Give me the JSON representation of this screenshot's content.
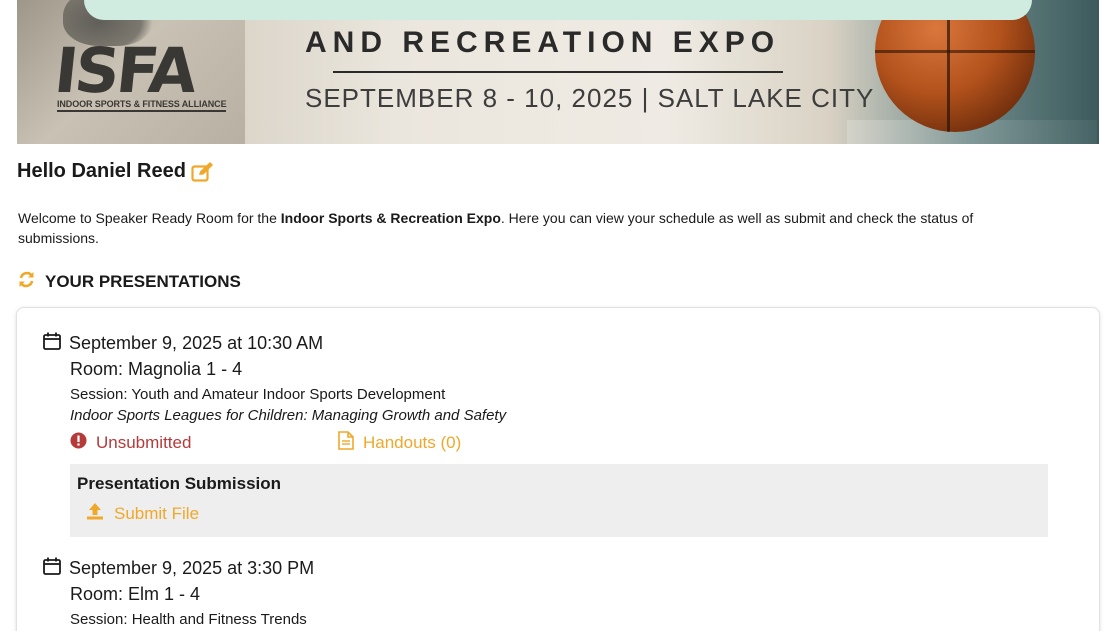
{
  "banner": {
    "logo_text": "ISFA",
    "logo_subtitle": "INDOOR SPORTS & FITNESS ALLIANCE",
    "expo_title": "AND RECREATION EXPO",
    "expo_date": "SEPTEMBER 8 - 10, 2025 | SALT LAKE CITY"
  },
  "greeting": {
    "text": "Hello Daniel Reed",
    "edit_icon": "edit-icon"
  },
  "welcome": {
    "prefix": "Welcome to Speaker Ready Room for the ",
    "event_name": "Indoor Sports & Recreation Expo",
    "suffix": ". Here you can view your schedule as well as submit and check the status of submissions."
  },
  "section": {
    "icon": "refresh-icon",
    "title": "YOUR PRESENTATIONS"
  },
  "presentations": [
    {
      "date": "September 9, 2025 at 10:30 AM",
      "room": "Room: Magnolia 1 - 4",
      "session": "Session: Youth and Amateur Indoor Sports Development",
      "title": "Indoor Sports Leagues for Children: Managing Growth and Safety",
      "status": "Unsubmitted",
      "handouts": "Handouts (0)",
      "submission_heading": "Presentation Submission",
      "submit_label": "Submit File"
    },
    {
      "date": "September 9, 2025 at 3:30 PM",
      "room": "Room: Elm 1 - 4",
      "session": "Session: Health and Fitness Trends"
    }
  ],
  "colors": {
    "accent": "#f0a82b",
    "error": "#b53a3a",
    "top_bar": "#d0ebe0"
  }
}
